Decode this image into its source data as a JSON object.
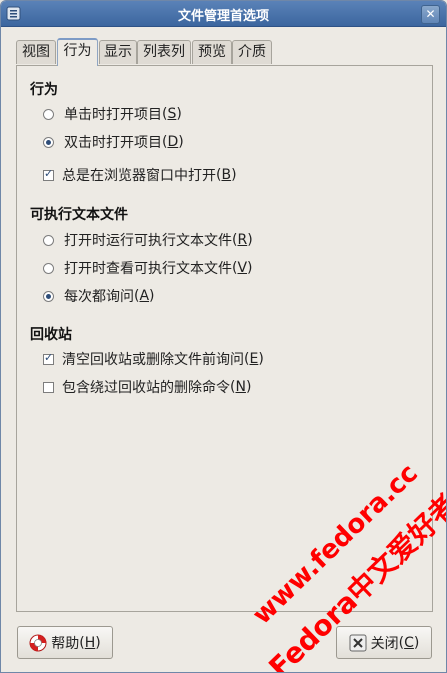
{
  "window": {
    "title": "文件管理首选项"
  },
  "tabs": [
    {
      "label": "视图",
      "active": false
    },
    {
      "label": "行为",
      "active": true
    },
    {
      "label": "显示",
      "active": false
    },
    {
      "label": "列表列",
      "active": false
    },
    {
      "label": "预览",
      "active": false
    },
    {
      "label": "介质",
      "active": false
    }
  ],
  "behavior": {
    "title": "行为",
    "single_click": {
      "label": "单击时打开项目",
      "key": "S",
      "selected": false
    },
    "double_click": {
      "label": "双击时打开项目",
      "key": "D",
      "selected": true
    },
    "open_in_browser": {
      "label": "总是在浏览器窗口中打开",
      "key": "B",
      "checked": true
    }
  },
  "executable": {
    "title": "可执行文本文件",
    "run": {
      "label": "打开时运行可执行文本文件",
      "key": "R",
      "selected": false
    },
    "view": {
      "label": "打开时查看可执行文本文件",
      "key": "V",
      "selected": false
    },
    "ask": {
      "label": "每次都询问",
      "key": "A",
      "selected": true
    }
  },
  "trash": {
    "title": "回收站",
    "confirm_empty": {
      "label": "清空回收站或删除文件前询问",
      "key": "E",
      "checked": true
    },
    "include_delete": {
      "label": "包含绕过回收站的删除命令",
      "key": "N",
      "checked": false
    }
  },
  "buttons": {
    "help": {
      "label": "帮助",
      "key": "H"
    },
    "close": {
      "label": "关闭",
      "key": "C"
    }
  },
  "watermark": {
    "line1": "www.fedora.cc",
    "line2": "Fedora中文爱好者"
  },
  "colors": {
    "titlebar": "#4a75ad",
    "accent": "#2e4d78",
    "watermark": "#ff0000"
  }
}
